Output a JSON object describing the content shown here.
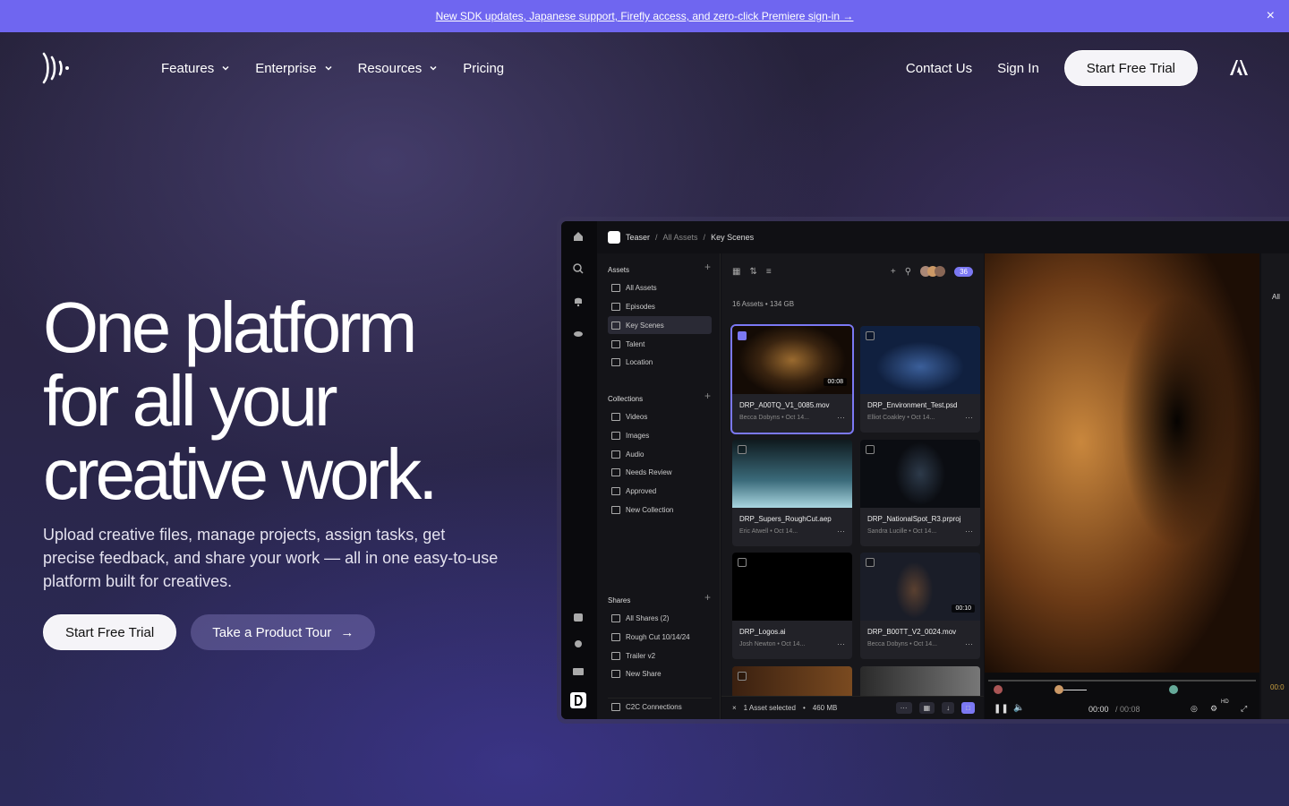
{
  "banner": {
    "text": "New SDK updates, Japanese support, Firefly access, and zero-click Premiere sign-in →",
    "close": "×"
  },
  "nav": {
    "items": [
      {
        "label": "Features"
      },
      {
        "label": "Enterprise"
      },
      {
        "label": "Resources"
      },
      {
        "label": "Pricing"
      }
    ],
    "contact": "Contact Us",
    "signin": "Sign In",
    "cta": "Start Free Trial"
  },
  "hero": {
    "title_lines": [
      "One platform",
      "for all your",
      "creative work."
    ],
    "subtitle": "Upload creative files, manage projects, assign tasks, get precise feedback, and share your work — all in one easy-to-use platform built for creatives.",
    "cta_primary": "Start Free Trial",
    "cta_secondary": "Take a Product Tour",
    "cta_secondary_arrow": "→"
  },
  "app": {
    "breadcrumb": {
      "project": "Teaser",
      "all": "All Assets",
      "current": "Key Scenes"
    },
    "assets_header": "Assets",
    "assets_tree": [
      "All Assets",
      "Episodes",
      "Key Scenes",
      "Talent",
      "Location"
    ],
    "collections_header": "Collections",
    "collections": [
      "Videos",
      "Images",
      "Audio",
      "Needs Review",
      "Approved",
      "New Collection"
    ],
    "shares_header": "Shares",
    "shares": [
      "All Shares (2)",
      "Rough Cut 10/14/24",
      "Trailer v2",
      "New Share"
    ],
    "c2c": "C2C Connections",
    "people_count": "36",
    "asset_count": "16 Assets",
    "asset_size": "134 GB",
    "cards": [
      {
        "name": "DRP_A00TQ_V1_0085.mov",
        "meta": "Becca Dobyns  •  Oct 14...",
        "duration": "00:08",
        "selected": true
      },
      {
        "name": "DRP_Environment_Test.psd",
        "meta": "Elliot Coakley  •  Oct 14...",
        "duration": "",
        "selected": false
      },
      {
        "name": "DRP_Supers_RoughCut.aep",
        "meta": "Eric Atwell  •  Oct 14...",
        "duration": "",
        "selected": false
      },
      {
        "name": "DRP_NationalSpot_R3.prproj",
        "meta": "Sandra Lucille  •  Oct 14...",
        "duration": "",
        "selected": false
      },
      {
        "name": "DRP_Logos.ai",
        "meta": "Josh Newton  •  Oct 14...",
        "duration": "",
        "selected": false
      },
      {
        "name": "DRP_B00TT_V2_0024.mov",
        "meta": "Becca Dobyns  •  Oct 14...",
        "duration": "00:10",
        "selected": false
      }
    ],
    "selection_text": "1 Asset selected",
    "selection_size": "460 MB",
    "player_time": "00:00",
    "player_total": "/ 00:08",
    "hd_label": "HD",
    "peek_label": "All",
    "peek_time": "00:0"
  },
  "colors": {
    "banner": "#6f66f0",
    "accent": "#7b78f3"
  }
}
